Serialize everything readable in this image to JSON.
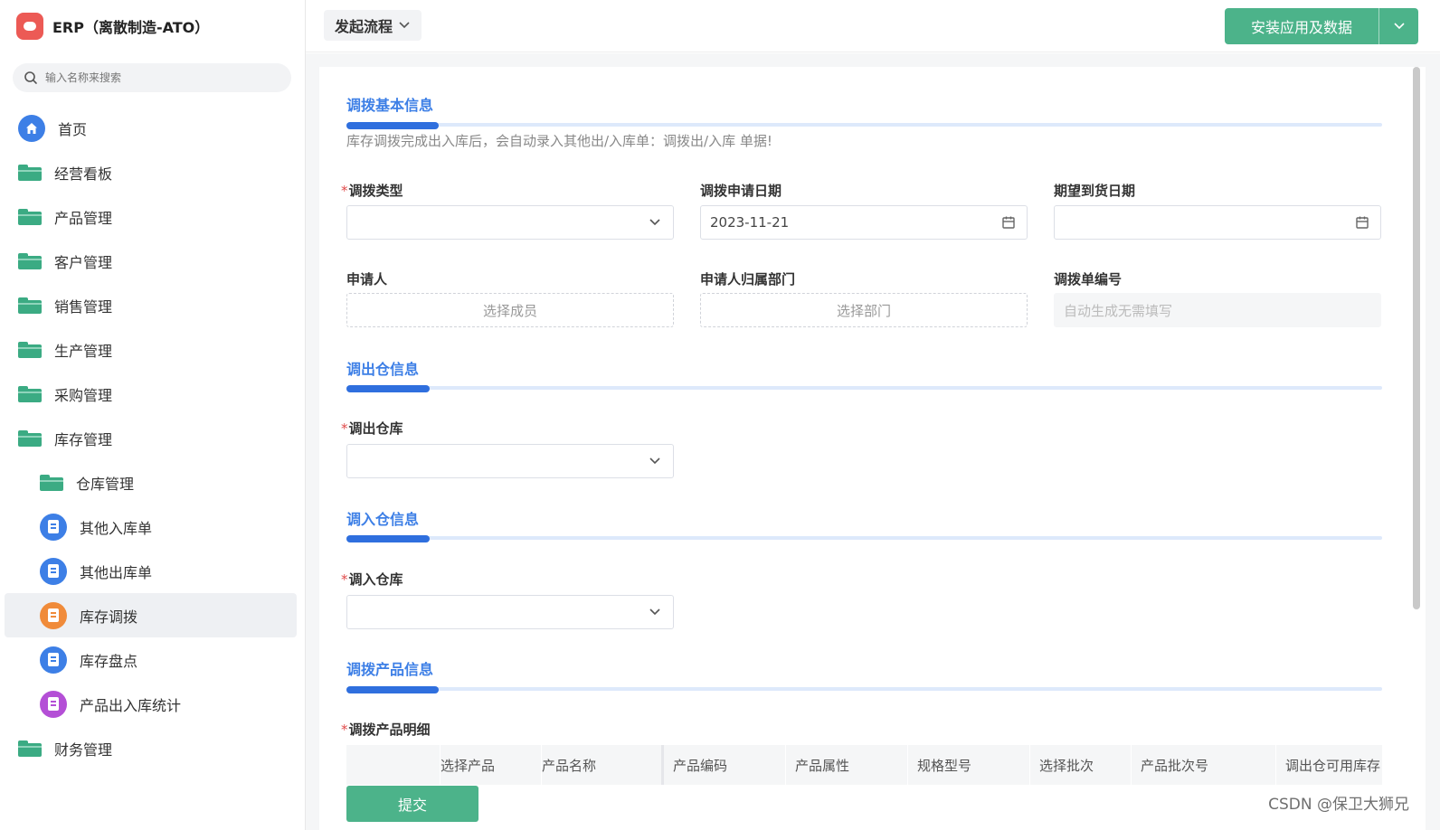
{
  "app": {
    "title": "ERP（离散制造-ATO）"
  },
  "search": {
    "placeholder": "输入名称来搜索"
  },
  "sidebar": {
    "items": [
      {
        "label": "首页"
      },
      {
        "label": "经营看板"
      },
      {
        "label": "产品管理"
      },
      {
        "label": "客户管理"
      },
      {
        "label": "销售管理"
      },
      {
        "label": "生产管理"
      },
      {
        "label": "采购管理"
      },
      {
        "label": "库存管理"
      },
      {
        "label": "仓库管理"
      },
      {
        "label": "其他入库单"
      },
      {
        "label": "其他出库单"
      },
      {
        "label": "库存调拨"
      },
      {
        "label": "库存盘点"
      },
      {
        "label": "产品出入库统计"
      },
      {
        "label": "财务管理"
      }
    ]
  },
  "header": {
    "flow_label": "发起流程",
    "install_label": "安装应用及数据"
  },
  "form": {
    "basic": {
      "title": "调拨基本信息",
      "hint": "库存调拨完成出入库后，会自动录入其他出/入库单：调拨出/入库 单据!",
      "type_label": "调拨类型",
      "type_value": "",
      "date_label": "调拨申请日期",
      "date_value": "2023-11-21",
      "expect_label": "期望到货日期",
      "expect_value": "",
      "applicant_label": "申请人",
      "applicant_placeholder": "选择成员",
      "dept_label": "申请人归属部门",
      "dept_placeholder": "选择部门",
      "number_label": "调拨单编号",
      "number_placeholder": "自动生成无需填写"
    },
    "out": {
      "title": "调出仓信息",
      "warehouse_label": "调出仓库",
      "warehouse_value": ""
    },
    "in": {
      "title": "调入仓信息",
      "warehouse_label": "调入仓库",
      "warehouse_value": ""
    },
    "products": {
      "title": "调拨产品信息",
      "detail_label": "调拨产品明细",
      "columns": [
        "选择产品",
        "产品名称",
        "产品编码",
        "产品属性",
        "规格型号",
        "选择批次",
        "产品批次号",
        "调出仓可用库存"
      ]
    },
    "submit_label": "提交",
    "required_mark": "*"
  },
  "watermark": "CSDN @保卫大狮兄",
  "colors": {
    "brand_green": "#4cb38a",
    "accent_blue": "#3d7fe6",
    "folder_green": "#3bab83",
    "logo_red": "#ec5a55"
  }
}
